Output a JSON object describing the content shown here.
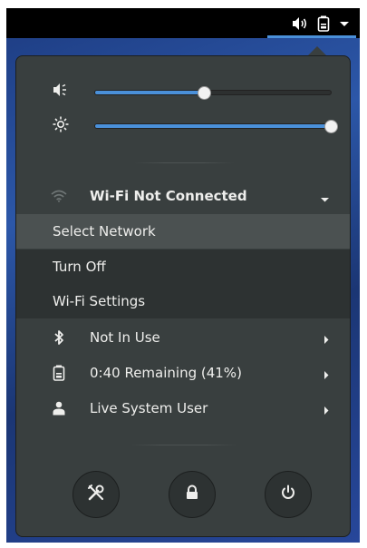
{
  "topbar": {
    "volume_icon": "speaker-volume-icon",
    "battery_icon": "battery-icon",
    "menu_arrow_icon": "dropdown-arrow-icon"
  },
  "sliders": {
    "volume": {
      "icon": "speaker-low-icon",
      "level": 0.46
    },
    "brightness": {
      "icon": "brightness-sun-icon",
      "level": 1.0
    }
  },
  "wifi": {
    "icon": "wifi-icon",
    "label": "Wi-Fi Not Connected",
    "expanded": true,
    "submenu": [
      {
        "label": "Select Network",
        "selected": true
      },
      {
        "label": "Turn Off",
        "selected": false
      },
      {
        "label": "Wi-Fi Settings",
        "selected": false
      }
    ]
  },
  "bluetooth": {
    "icon": "bluetooth-icon",
    "label": "Not In Use"
  },
  "battery": {
    "icon": "battery-icon",
    "label": "0:40 Remaining (41%)"
  },
  "user": {
    "icon": "user-icon",
    "label": "Live System User"
  },
  "actions": [
    {
      "name": "settings-button",
      "icon": "settings-tools-icon"
    },
    {
      "name": "lock-button",
      "icon": "lock-icon"
    },
    {
      "name": "power-button",
      "icon": "power-icon"
    }
  ],
  "colors": {
    "menu_background": "#393f3f",
    "accent": "#4a90d9",
    "text": "#eeeeec",
    "highlight": "#4b5151"
  }
}
